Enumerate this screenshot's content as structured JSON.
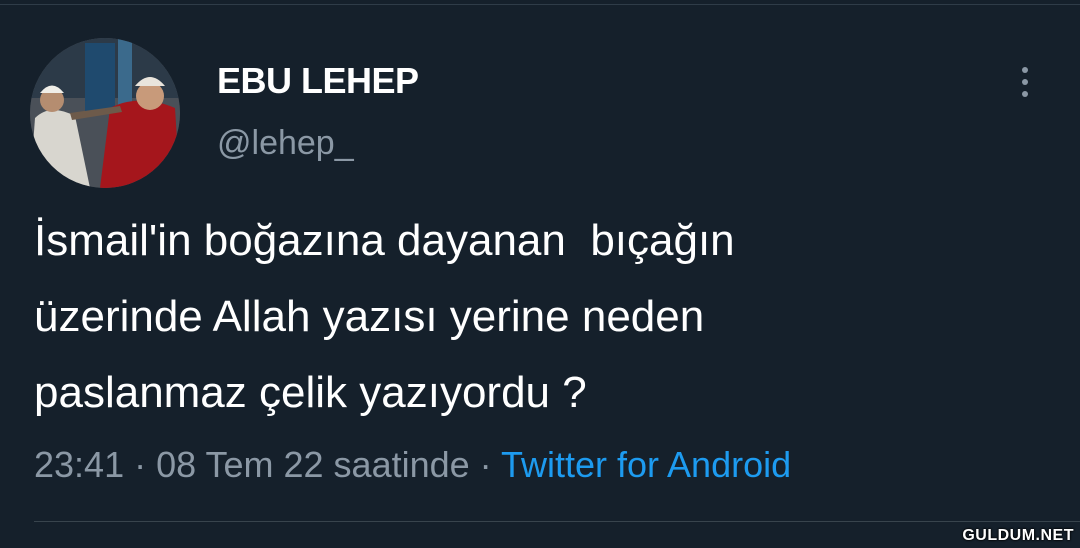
{
  "tweet": {
    "author": {
      "display_name": "EBU LEHEP",
      "handle": "@lehep_",
      "avatar": "avatar-photo"
    },
    "more_icon": "more-vertical-icon",
    "text_lines": [
      "İsmail'in boğazına dayanan  bıçağın",
      "üzerinde Allah yazısı yerine neden",
      "paslanmaz çelik yazıyordu ?"
    ],
    "meta": {
      "time": "23:41",
      "separator": " · ",
      "date": "08 Tem 22 saatinde",
      "source": "Twitter for Android"
    }
  },
  "watermark": "GULDUM.NET",
  "colors": {
    "background": "#15202b",
    "primary_text": "#ffffff",
    "secondary_text": "#8b98a5",
    "link": "#1d9bf0",
    "divider": "#38444d"
  }
}
